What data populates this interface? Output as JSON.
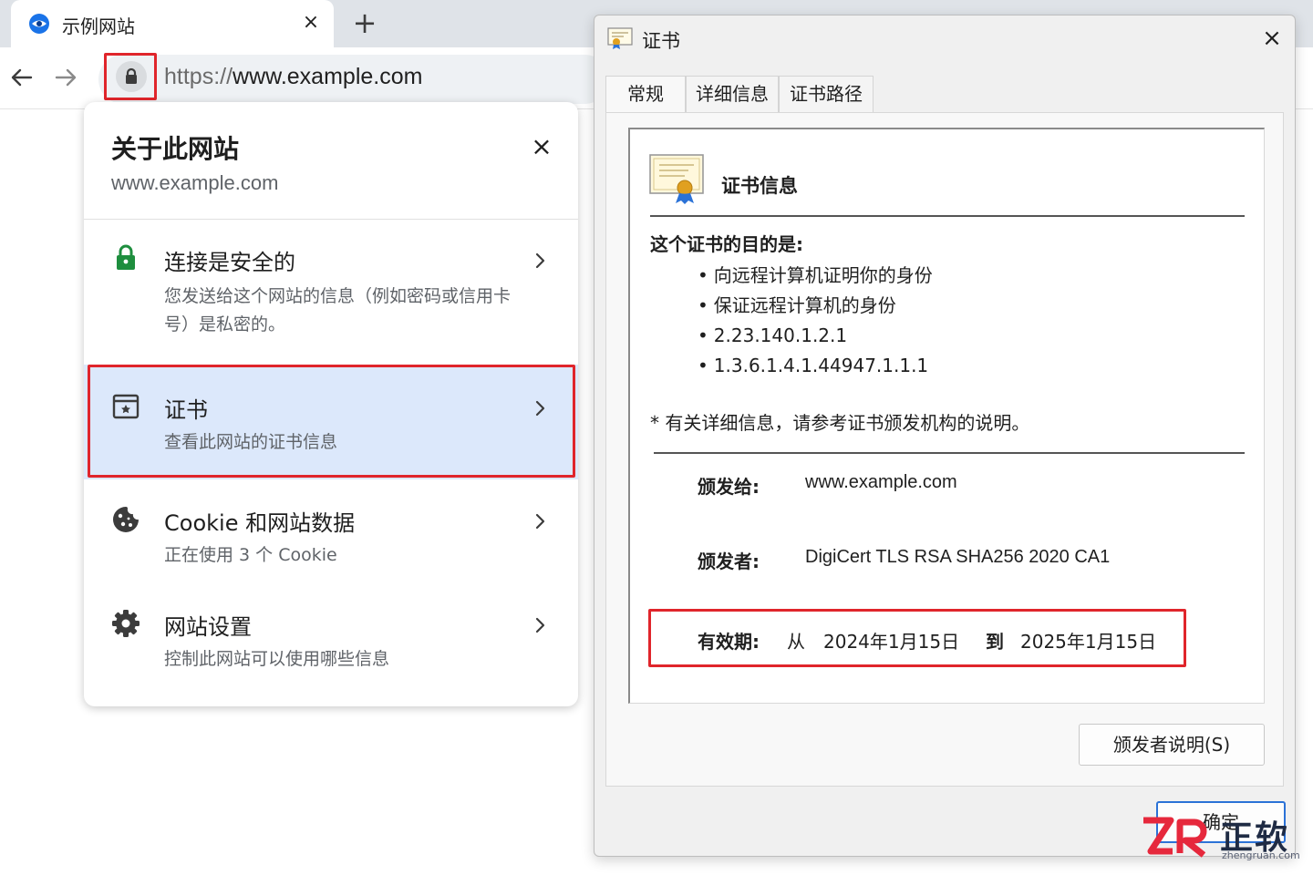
{
  "browser": {
    "tab_title": "示例网站",
    "tab_close_glyph": "×",
    "new_tab_glyph": "+",
    "url_scheme": "https://",
    "url_host": "www.example.com"
  },
  "site_info": {
    "title": "关于此网站",
    "domain": "www.example.com",
    "close_glyph": "×",
    "rows": [
      {
        "icon": "lock-icon",
        "title": "连接是安全的",
        "subtitle": "您发送给这个网站的信息（例如密码或信用卡号）是私密的。"
      },
      {
        "icon": "certificate-icon",
        "title": "证书",
        "subtitle": "查看此网站的证书信息"
      },
      {
        "icon": "cookie-icon",
        "title": "Cookie 和网站数据",
        "subtitle": "正在使用 3 个 Cookie"
      },
      {
        "icon": "gear-icon",
        "title": "网站设置",
        "subtitle": "控制此网站可以使用哪些信息"
      }
    ]
  },
  "cert_dialog": {
    "title": "证书",
    "close_glyph": "×",
    "tabs": [
      "常规",
      "详细信息",
      "证书路径"
    ],
    "heading": "证书信息",
    "purpose_label": "这个证书的目的是:",
    "purposes": [
      "向远程计算机证明你的身份",
      "保证远程计算机的身份",
      "2.23.140.1.2.1",
      "1.3.6.1.4.1.44947.1.1.1"
    ],
    "note": "* 有关详细信息，请参考证书颁发机构的说明。",
    "issued_to_label": "颁发给:",
    "issued_to": "www.example.com",
    "issued_by_label": "颁发者:",
    "issued_by": "DigiCert TLS RSA SHA256 2020 CA1",
    "validity_label": "有效期:",
    "validity_from_word": "从",
    "valid_from": "2024年1月15日",
    "validity_to_word": "到",
    "valid_to": "2025年1月15日",
    "issuer_statement_button": "颁发者说明(S)",
    "ok_button": "确定"
  },
  "watermark": {
    "name": "正软",
    "domain": "zhengruan.com"
  },
  "colors": {
    "highlight_red": "#e0252b",
    "cert_row_bg": "#dce8fb",
    "secure_green": "#1e8e3e",
    "ok_border": "#2b72d7",
    "watermark_red": "#e6283c"
  }
}
